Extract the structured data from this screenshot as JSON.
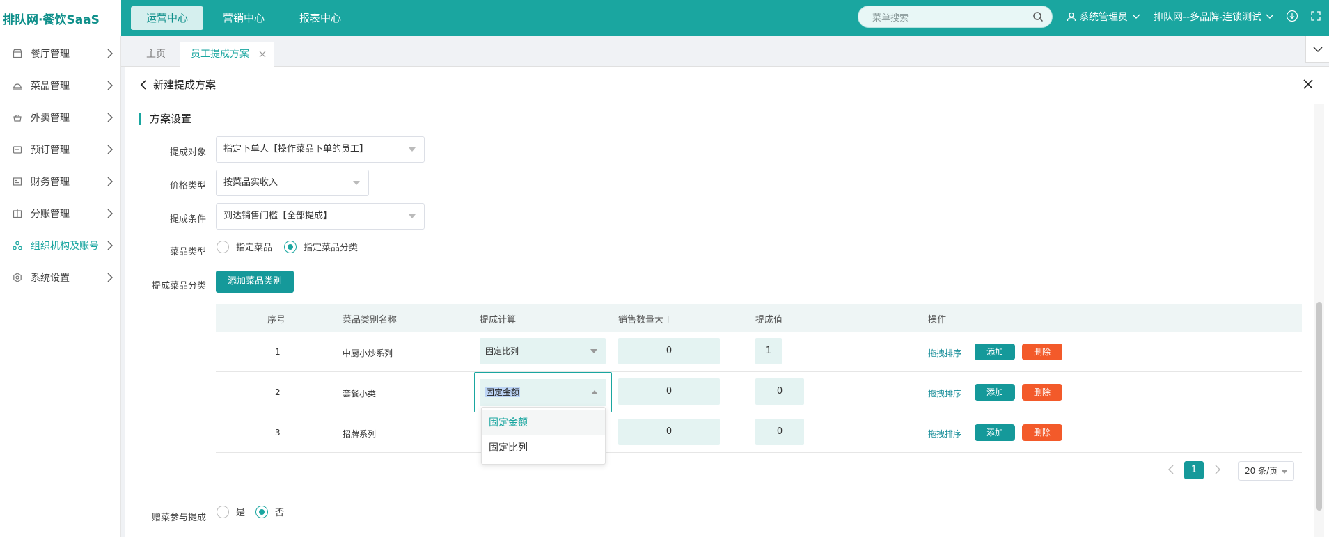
{
  "app": {
    "logo_text_main": "排队网·餐饮SaaS"
  },
  "topnav": {
    "items": [
      "运营中心",
      "营销中心",
      "报表中心"
    ],
    "active_index": 0
  },
  "search": {
    "placeholder": "菜单搜索",
    "icon": "search-icon"
  },
  "user": {
    "name": "系统管理员",
    "brand": "排队网--多品牌-连锁测试"
  },
  "sidebar": {
    "items": [
      {
        "label": "餐厅管理",
        "icon": "store-icon"
      },
      {
        "label": "菜品管理",
        "icon": "dish-icon"
      },
      {
        "label": "外卖管理",
        "icon": "delivery-icon"
      },
      {
        "label": "预订管理",
        "icon": "reservation-icon"
      },
      {
        "label": "财务管理",
        "icon": "finance-icon"
      },
      {
        "label": "分账管理",
        "icon": "split-icon"
      },
      {
        "label": "组织机构及账号",
        "icon": "org-icon"
      },
      {
        "label": "系统设置",
        "icon": "settings-icon"
      }
    ],
    "active_index": 6
  },
  "tabs": {
    "home": "主页",
    "active": "员工提成方案"
  },
  "page": {
    "title": "新建提成方案",
    "section_title": "方案设置"
  },
  "form": {
    "commission_target": {
      "label": "提成对象",
      "value": "指定下单人【操作菜品下单的员工】"
    },
    "price_type": {
      "label": "价格类型",
      "value": "按菜品实收入"
    },
    "commission_condition": {
      "label": "提成条件",
      "value": "到达销售门槛【全部提成】"
    },
    "dish_type": {
      "label": "菜品类型",
      "options": [
        "指定菜品",
        "指定菜品分类"
      ],
      "selected": "指定菜品分类"
    },
    "commission_category": {
      "label": "提成菜品分类",
      "add_button": "添加菜品类别"
    },
    "gift_dish": {
      "label": "赠菜参与提成",
      "options": [
        "是",
        "否"
      ],
      "selected": "否"
    }
  },
  "table": {
    "headers": [
      "序号",
      "菜品类别名称",
      "提成计算",
      "销售数量大于",
      "提成值",
      "操作"
    ],
    "rows": [
      {
        "index": "1",
        "name": "中厨小炒系列",
        "calc": "固定比列",
        "qty": "0",
        "value": "1"
      },
      {
        "index": "2",
        "name": "套餐小类",
        "calc": "固定金额",
        "qty": "0",
        "value": "0"
      },
      {
        "index": "3",
        "name": "招牌系列",
        "calc": "",
        "qty": "0",
        "value": "0"
      }
    ],
    "actions": {
      "drag": "拖拽排序",
      "add": "添加",
      "delete": "删除"
    }
  },
  "dropdown": {
    "options": [
      "固定金额",
      "固定比列"
    ],
    "highlighted": "固定金额"
  },
  "pagination": {
    "current_page": "1",
    "page_size": "20 条/页"
  },
  "colors": {
    "primary": "#1aa6a0",
    "button": "#15999a",
    "danger": "#f35a2a"
  }
}
